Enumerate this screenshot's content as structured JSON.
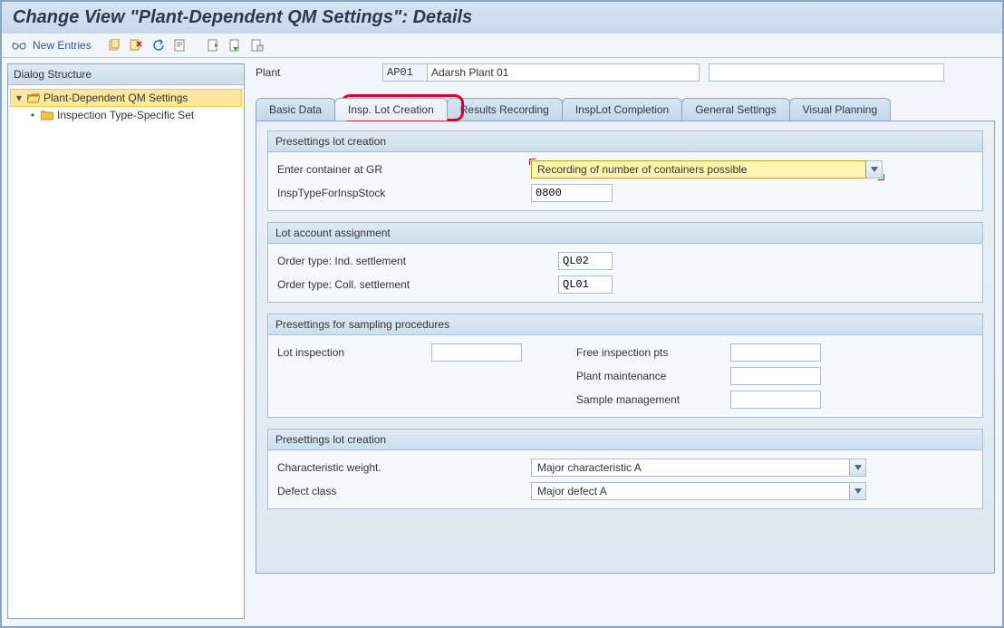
{
  "title": "Change View \"Plant-Dependent QM Settings\": Details",
  "toolbar": {
    "new_entries": "New Entries"
  },
  "sidebar": {
    "header": "Dialog Structure",
    "items": [
      {
        "label": "Plant-Dependent QM Settings"
      },
      {
        "label": "Inspection Type-Specific Set"
      }
    ]
  },
  "header": {
    "plant_label": "Plant",
    "plant_code": "AP01",
    "plant_desc": "Adarsh Plant 01"
  },
  "tabs": [
    "Basic Data",
    "Insp. Lot Creation",
    "Results Recording",
    "InspLot Completion",
    "General Settings",
    "Visual Planning"
  ],
  "group1": {
    "title": "Presettings lot creation",
    "enter_container_label": "Enter container at GR",
    "enter_container_value": "Recording of number of containers possible",
    "insp_type_label": "InspTypeForInspStock",
    "insp_type_value": "0800"
  },
  "group2": {
    "title": "Lot account assignment",
    "ind_label": "Order type: Ind. settlement",
    "ind_value": "QL02",
    "coll_label": "Order type: Coll. settlement",
    "coll_value": "QL01"
  },
  "group3": {
    "title": "Presettings for sampling procedures",
    "lot_insp_label": "Lot inspection",
    "free_pts_label": "Free inspection pts",
    "plant_maint_label": "Plant maintenance",
    "sample_mgmt_label": "Sample management"
  },
  "group4": {
    "title": "Presettings lot creation",
    "char_weight_label": "Characteristic weight.",
    "char_weight_value": "Major characteristic A",
    "defect_class_label": "Defect class",
    "defect_class_value": "Major defect A"
  }
}
